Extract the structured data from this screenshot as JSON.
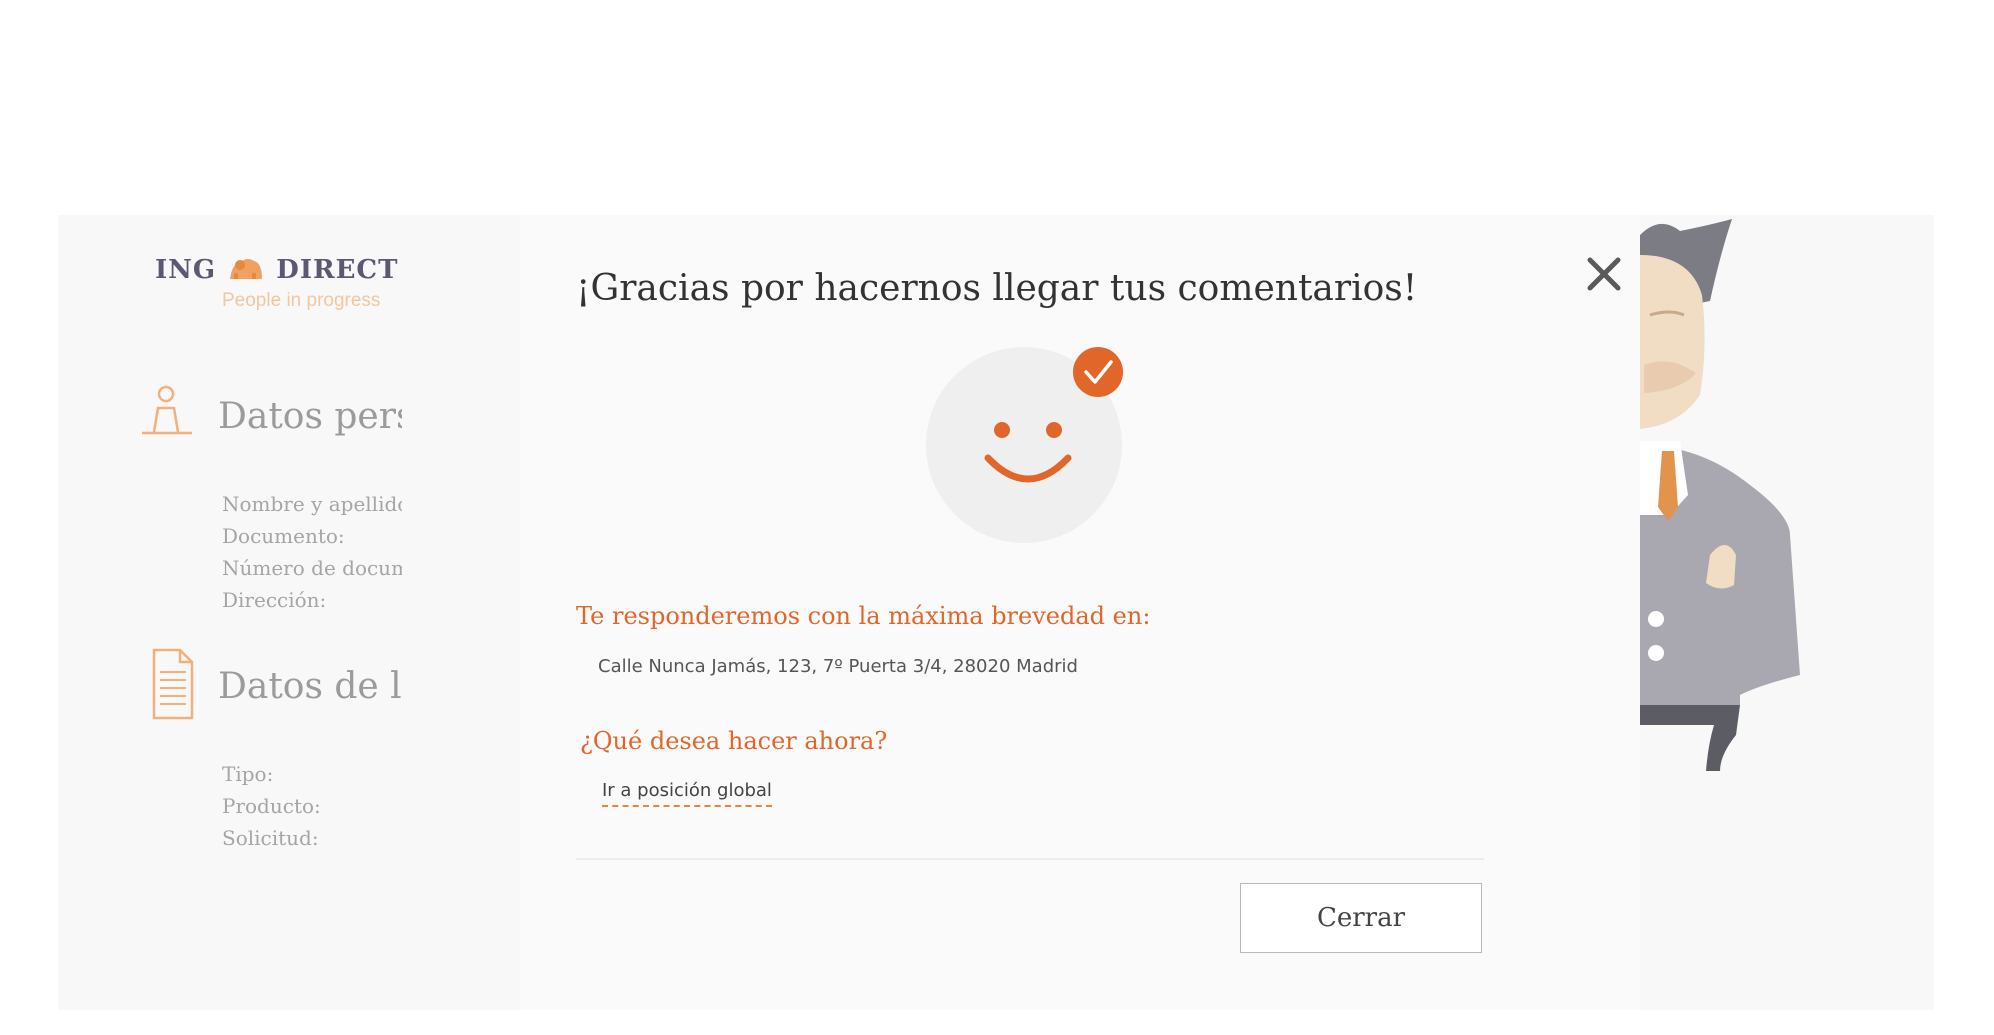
{
  "brand": {
    "name_left": "ING",
    "name_right": "DIRECT",
    "tagline": "People in progress"
  },
  "background": {
    "sections": [
      {
        "title": "Datos personales",
        "icon": "person-icon",
        "fields": [
          "Nombre y apellidos:",
          "Documento:",
          "Número de documento:",
          "Dirección:"
        ]
      },
      {
        "title": "Datos de la solicitud",
        "icon": "document-icon",
        "fields": [
          "Tipo:",
          "Producto:",
          "Solicitud:"
        ]
      }
    ]
  },
  "modal": {
    "title": "¡Gracias por hacernos llegar tus comentarios!",
    "response_label": "Te responderemos con la máxima brevedad en:",
    "address": "Calle Nunca Jamás, 123, 7º Puerta 3/4, 28020 Madrid",
    "next_label": "¿Qué desea hacer ahora?",
    "global_link": "Ir a posición global",
    "close_button": "Cerrar",
    "close_icon": "close-icon",
    "status_icon": "smiley-check-icon"
  },
  "colors": {
    "accent": "#e0662a",
    "text": "#333333",
    "muted": "#a5a5a5"
  }
}
